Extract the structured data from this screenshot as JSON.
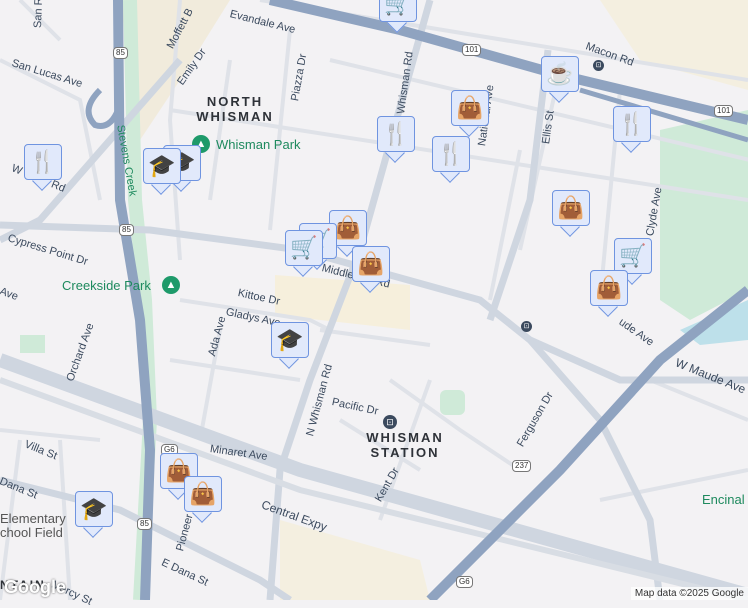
{
  "areas": {
    "north_whisman": "NORTH\nWHISMAN",
    "whisman_station": "WHISMAN\nSTATION",
    "mountain_view": "NTAIN"
  },
  "parks": {
    "whisman_park": "Whisman Park",
    "creekside_park": "Creekside Park",
    "stevens_creek": "Stevens Creek",
    "elementary": "Elementary\nchool Field",
    "encinal": "Encinal"
  },
  "streets": {
    "evandale": "Evandale Ave",
    "moffett": "Moffett B",
    "san_lucas": "San Lucas Ave",
    "san_r": "San R",
    "emily": "Emily Dr",
    "piazza": "Piazza Dr",
    "whisman_rd": "Whisman Rd",
    "n_whisman": "N Whisman Rd",
    "national": "National Ave",
    "ellis": "Ellis St",
    "macon": "Macon Rd",
    "clyde": "Clyde Ave",
    "middlefield_w": "W    efield Rd",
    "cypress": "Cypress Point Dr",
    "middlefield": "Middlefield Rd",
    "kittoe": "Kittoe Dr",
    "gladys": "Gladys Ave",
    "ada": "Ada Ave",
    "orchard": "Orchard Ave",
    "maude": "W Maude Ave",
    "maude2": "ude Ave",
    "pacific": "Pacific Dr",
    "ferguson": "Ferguson Dr",
    "minaret": "Minaret Ave",
    "kent": "Kent Dr",
    "central": "Central Expy",
    "villa": "Villa St",
    "dana": "E Dana St",
    "dana_w": "Dana St",
    "pioneer": "Pioneer",
    "mercy": "Mercy St",
    "ave_w": "Ave"
  },
  "shields": {
    "hwy101": "101",
    "hwy85": "85",
    "hwy237": "237",
    "g6": "G6"
  },
  "markers": [
    {
      "type": "grocery",
      "icon": "🛒"
    },
    {
      "type": "cafe",
      "icon": "☕"
    },
    {
      "type": "shopping",
      "icon": "👜"
    },
    {
      "type": "restaurant",
      "icon": "🍴"
    },
    {
      "type": "restaurant",
      "icon": "🍴"
    },
    {
      "type": "restaurant",
      "icon": "🍴"
    },
    {
      "type": "restaurant",
      "icon": "🍴"
    },
    {
      "type": "school",
      "icon": "🎓"
    },
    {
      "type": "school",
      "icon": "🎓"
    },
    {
      "type": "shopping",
      "icon": "👜"
    },
    {
      "type": "grocery",
      "icon": "🛒"
    },
    {
      "type": "shopping",
      "icon": "👜"
    },
    {
      "type": "shopping",
      "icon": "👜"
    },
    {
      "type": "grocery",
      "icon": "🛒"
    },
    {
      "type": "grocery",
      "icon": "🛒"
    },
    {
      "type": "shopping",
      "icon": "👜"
    },
    {
      "type": "school",
      "icon": "🎓"
    },
    {
      "type": "shopping",
      "icon": "👜"
    },
    {
      "type": "shopping",
      "icon": "👜"
    },
    {
      "type": "school",
      "icon": "🎓"
    }
  ],
  "attribution": "Map data ©2025 Google",
  "logo": "Google"
}
